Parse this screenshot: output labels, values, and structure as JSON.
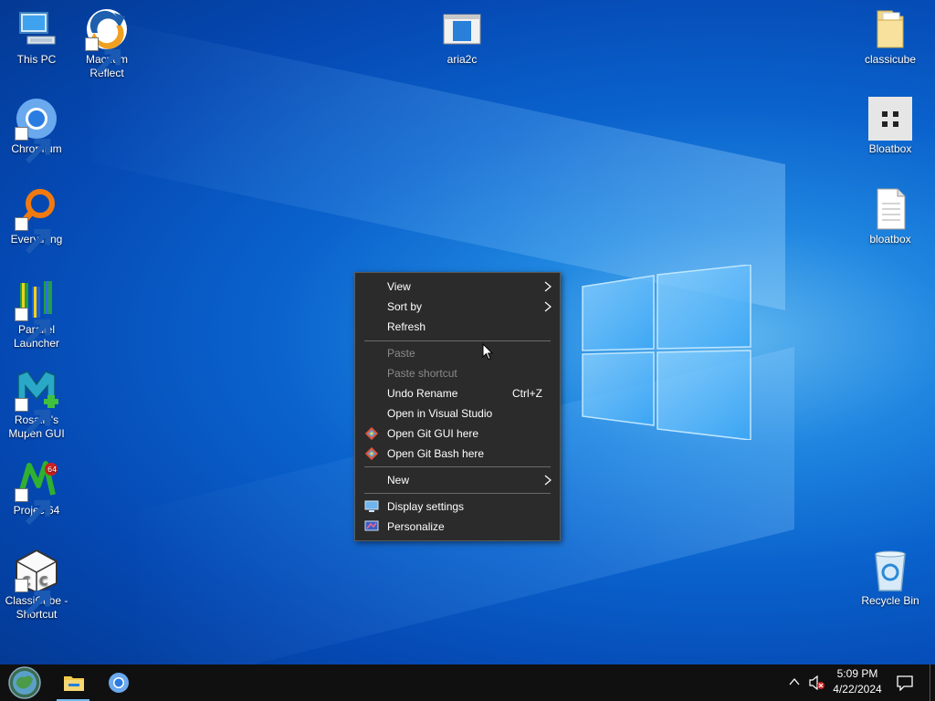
{
  "desktop": {
    "icons": {
      "this_pc": "This PC",
      "macrium": "Macrium Reflect",
      "aria2c": "aria2c",
      "classicube": "classicube",
      "chromium": "Chromium",
      "bloatbox_app": "Bloatbox",
      "everything": "Everything",
      "bloatbox_file": "bloatbox",
      "parallel": "Parallel Launcher",
      "rosalie": "Rosalie's Mupen GUI",
      "project64": "Project64",
      "classicube_shortcut": "ClassiCube - Shortcut",
      "recycle_bin": "Recycle Bin"
    }
  },
  "context_menu": {
    "view": "View",
    "sort_by": "Sort by",
    "refresh": "Refresh",
    "paste": "Paste",
    "paste_shortcut": "Paste shortcut",
    "undo_rename": "Undo Rename",
    "undo_shortcut": "Ctrl+Z",
    "open_vs": "Open in Visual Studio",
    "git_gui": "Open Git GUI here",
    "git_bash": "Open Git Bash here",
    "new": "New",
    "display_settings": "Display settings",
    "personalize": "Personalize"
  },
  "taskbar": {
    "time": "5:09 PM",
    "date": "4/22/2024"
  },
  "colors": {
    "menu_bg": "#2b2b2b",
    "taskbar_bg": "#101010",
    "accent": "#76b9ed"
  }
}
